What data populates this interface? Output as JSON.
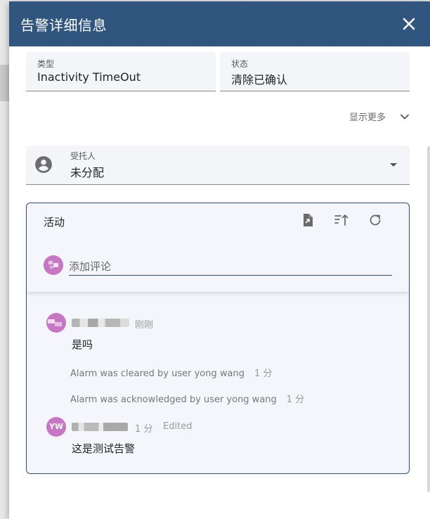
{
  "dialog": {
    "title": "告警详细信息"
  },
  "fields": {
    "type": {
      "label": "类型",
      "value": "Inactivity TimeOut"
    },
    "status": {
      "label": "状态",
      "value": "清除已确认"
    }
  },
  "show_more": {
    "label": "显示更多"
  },
  "assignee": {
    "label": "受托人",
    "value": "未分配"
  },
  "activity": {
    "title": "活动",
    "comment_placeholder": "添加评论",
    "comments": [
      {
        "avatar_initials": "",
        "time": "刚刚",
        "text": "是吗",
        "edited": ""
      },
      {
        "avatar_initials": "YW",
        "time": "1 分",
        "text": "这是测试告警",
        "edited": "Edited"
      }
    ],
    "system_messages": [
      {
        "text": "Alarm was cleared by user yong wang",
        "time": "1 分"
      },
      {
        "text": "Alarm was acknowledged by user yong wang",
        "time": "1 分"
      }
    ]
  },
  "colors": {
    "titlebar": "#305680",
    "avatar": "#c676c3",
    "activity_border": "#2d4f77"
  }
}
